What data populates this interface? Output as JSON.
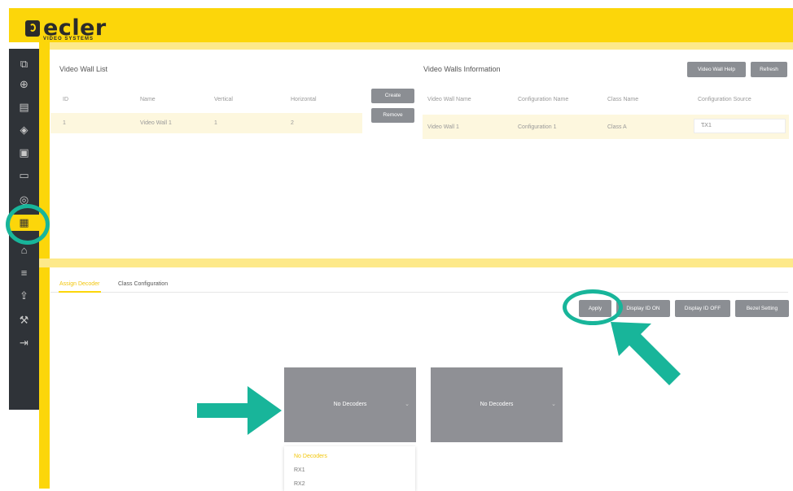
{
  "brand": {
    "name": "ecler",
    "subtitle": "VIDEO SYSTEMS"
  },
  "sidebar": {
    "items": [
      {
        "icon": "monitor-search-icon",
        "glyph": "⧉"
      },
      {
        "icon": "plus-circle-icon",
        "glyph": "⊕"
      },
      {
        "icon": "grid-icon",
        "glyph": "▤"
      },
      {
        "icon": "layers-icon",
        "glyph": "◈"
      },
      {
        "icon": "picture-icon",
        "glyph": "▣"
      },
      {
        "icon": "display-icon",
        "glyph": "▭"
      },
      {
        "icon": "fingerprint-icon",
        "glyph": "◎"
      },
      {
        "icon": "video-wall-icon",
        "glyph": "▦",
        "active": true
      },
      {
        "icon": "user-icon",
        "glyph": "⌂"
      },
      {
        "icon": "sliders-icon",
        "glyph": "≡"
      },
      {
        "icon": "upload-icon",
        "glyph": "⇪"
      },
      {
        "icon": "wrench-icon",
        "glyph": "⚒"
      },
      {
        "icon": "logout-icon",
        "glyph": "⇥"
      }
    ]
  },
  "video_wall_list": {
    "title": "Video Wall List",
    "columns": [
      "ID",
      "Name",
      "Vertical",
      "Horizontal"
    ],
    "rows": [
      {
        "id": "1",
        "name": "Video Wall 1",
        "vertical": "1",
        "horizontal": "2"
      }
    ],
    "create_label": "Create",
    "remove_label": "Remove"
  },
  "video_walls_info": {
    "title": "Video Walls Information",
    "help_label": "Video Wall Help",
    "refresh_label": "Refresh",
    "columns": [
      "Video Wall Name",
      "Configuration Name",
      "Class Name",
      "Configuration Source"
    ],
    "rows": [
      {
        "wall": "Video Wall 1",
        "config": "Configuration 1",
        "class": "Class A",
        "source": "TX1"
      }
    ]
  },
  "tabs": [
    {
      "label": "Assign Decoder",
      "active": true
    },
    {
      "label": "Class Configuration",
      "active": false
    }
  ],
  "actions": {
    "apply": "Apply",
    "display_on": "Display ID ON",
    "display_off": "Display ID OFF",
    "bezel": "Bezel Setting"
  },
  "walls": [
    {
      "label": "No Decoders"
    },
    {
      "label": "No Decoders"
    }
  ],
  "decoder_dropdown": {
    "options": [
      "No Decoders",
      "RX1",
      "RX2"
    ],
    "selected": "No Decoders"
  },
  "colors": {
    "brand_yellow": "#fcd60a",
    "sidebar": "#2f3338",
    "button_gray": "#8b8e93",
    "highlight_teal": "#18b59a"
  }
}
